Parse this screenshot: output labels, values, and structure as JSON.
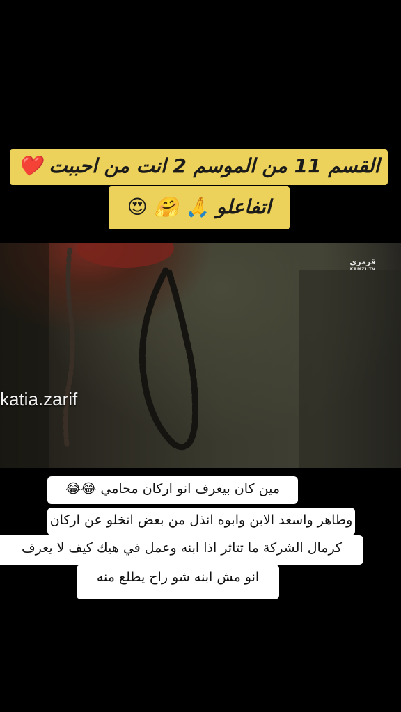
{
  "overlay_title": {
    "line1": "القسم 11 من الموسم 2 انت من احببت ❤️",
    "line2": "اتفاعلو 🙏 🤗 😍"
  },
  "video": {
    "watermark": "katia.zarif",
    "channel_logo": "قرمزي",
    "channel_logo_sub": "KRMZI.TV"
  },
  "caption": {
    "line1": "مين كان بيعرف انو اركان محامي 😂😂",
    "line2": "وطاهر واسعد الابن وابوه انذل من بعض اتخلو عن اركان",
    "line3": "كرمال الشركة ما تتاثر اذا ابنه وعمل في هيك كيف لا يعرف",
    "line4": "انو مش ابنه شو راح يطلع منه"
  }
}
